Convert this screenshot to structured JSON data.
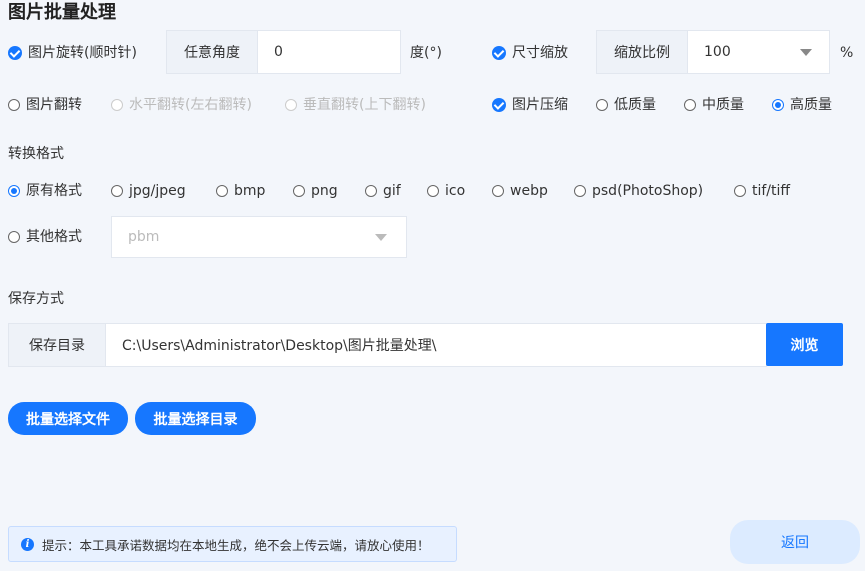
{
  "page": {
    "title": "图片批量处理"
  },
  "rotate": {
    "label": "图片旋转(顺时针)",
    "angle_label": "任意角度",
    "angle_value": "0",
    "unit": "度(°)"
  },
  "resize": {
    "label": "尺寸缩放",
    "ratio_label": "缩放比例",
    "ratio_value": "100",
    "unit": "%"
  },
  "flip": {
    "label": "图片翻转",
    "horizontal": "水平翻转(左右翻转)",
    "vertical": "垂直翻转(上下翻转)"
  },
  "compress": {
    "label": "图片压缩",
    "options": [
      "低质量",
      "中质量",
      "高质量"
    ],
    "selected": "高质量"
  },
  "format": {
    "section_title": "转换格式",
    "options": [
      "原有格式",
      "jpg/jpeg",
      "bmp",
      "png",
      "gif",
      "ico",
      "webp",
      "psd(PhotoShop)",
      "tif/tiff"
    ],
    "selected": "原有格式",
    "other_label": "其他格式",
    "other_value": "pbm"
  },
  "save": {
    "section_title": "保存方式",
    "dir_label": "保存目录",
    "dir_path": "C:\\Users\\Administrator\\Desktop\\图片批量处理\\",
    "browse": "浏览"
  },
  "actions": {
    "select_files": "批量选择文件",
    "select_dir": "批量选择目录",
    "back": "返回"
  },
  "tip": {
    "text": "提示：本工具承诺数据均在本地生成，绝不会上传云端，请放心使用！"
  },
  "colors": {
    "accent": "#1677ff",
    "background": "#f3f6fb"
  }
}
